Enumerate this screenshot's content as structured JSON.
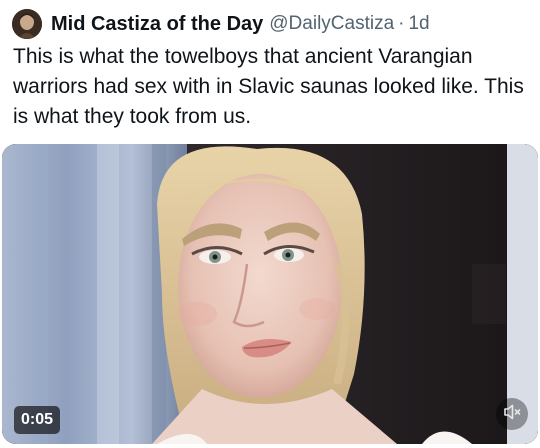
{
  "author": {
    "display_name": "Mid Castiza of the Day",
    "handle": "@DailyCastiza",
    "separator": "·",
    "time": "1d"
  },
  "tweet": {
    "text": "This is what the towelboys that ancient Varangian warriors had sex with in Slavic saunas looked like. This is what they took from us."
  },
  "video": {
    "timestamp": "0:05",
    "mute_icon": "speaker-muted-icon"
  }
}
